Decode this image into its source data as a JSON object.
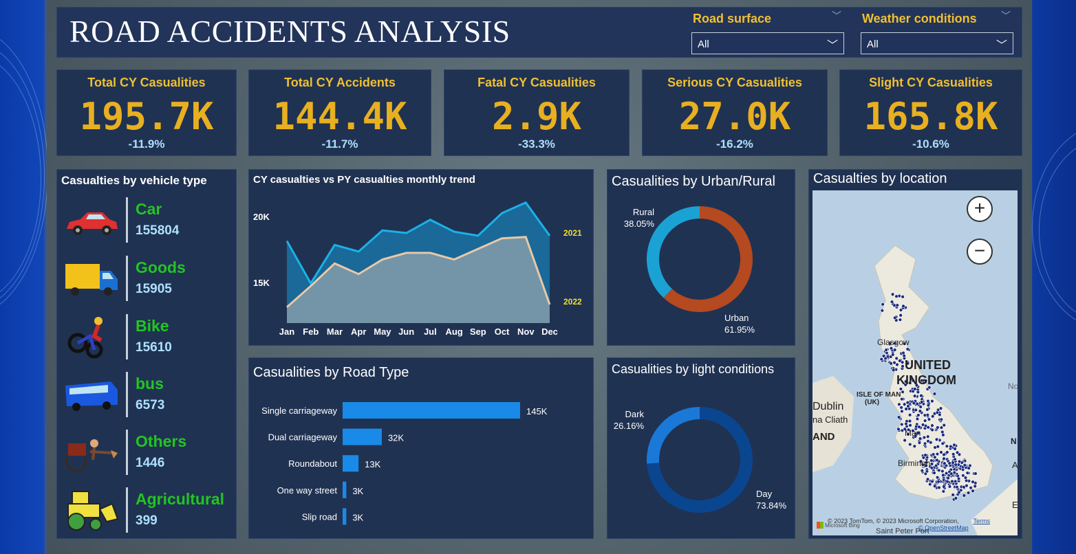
{
  "header": {
    "title": "ROAD ACCIDENTS ANALYSIS"
  },
  "filters": {
    "road_surface": {
      "label": "Road surface",
      "value": "All"
    },
    "weather": {
      "label": "Weather conditions",
      "value": "All"
    }
  },
  "kpis": [
    {
      "label": "Total CY Casualities",
      "value": "195.7K",
      "change": "-11.9%"
    },
    {
      "label": "Total CY Accidents",
      "value": "144.4K",
      "change": "-11.7%"
    },
    {
      "label": "Fatal CY Casualities",
      "value": "2.9K",
      "change": "-33.3%"
    },
    {
      "label": "Serious CY Casualities",
      "value": "27.0K",
      "change": "-16.2%"
    },
    {
      "label": "Slight CY Casualities",
      "value": "165.8K",
      "change": "-10.6%"
    }
  ],
  "vehicle_panel": {
    "title": "Casualties by vehicle type",
    "items": [
      {
        "name": "Car",
        "value": "155804",
        "icon": "car-icon"
      },
      {
        "name": "Goods",
        "value": "15905",
        "icon": "truck-icon"
      },
      {
        "name": "Bike",
        "value": "15610",
        "icon": "motorbike-icon"
      },
      {
        "name": "bus",
        "value": "6573",
        "icon": "bus-icon"
      },
      {
        "name": "Others",
        "value": "1446",
        "icon": "rickshaw-icon"
      },
      {
        "name": "Agricultural",
        "value": "399",
        "icon": "tractor-icon"
      }
    ]
  },
  "trend": {
    "title": "CY casualties vs PY casualties monthly trend"
  },
  "urban_rural": {
    "title": "Casualities by Urban/Rural"
  },
  "road_type": {
    "title": "Casualities by Road Type"
  },
  "light": {
    "title": "Casualities by light conditions"
  },
  "location": {
    "title": "Casualties by location",
    "labels": {
      "uk1": "UNITED",
      "uk2": "KINGDOM",
      "iom": "ISLE OF MAN",
      "iom2": "(UK)",
      "dublin": "Dublin",
      "glasgow": "Glasgow",
      "n": "N",
      "no": "No",
      "a": "A",
      "e": "E",
      "and": "AND",
      "cliath": "na Cliath",
      "man": "Man",
      "birm": "Birmingh"
    },
    "attribution": "© 2023 TomTom, © 2023 Microsoft Corporation,",
    "terms": "Terms",
    "osm": "© OpenStreetMap",
    "bing": "Microsoft Bing",
    "place": "Saint Peter Port",
    "zoom_in": "+",
    "zoom_out": "−"
  },
  "chart_data": [
    {
      "type": "area",
      "title": "CY casualties vs PY casualties monthly trend",
      "categories": [
        "Jan",
        "Feb",
        "Mar",
        "Apr",
        "May",
        "Jun",
        "Jul",
        "Aug",
        "Sep",
        "Oct",
        "Nov",
        "Dec"
      ],
      "y_ticks": [
        "15K",
        "20K"
      ],
      "ylim": [
        12000,
        21500
      ],
      "series": [
        {
          "name": "2021",
          "values": [
            18200,
            15000,
            17900,
            17400,
            19000,
            18800,
            19800,
            18900,
            18600,
            20300,
            21100,
            18600
          ],
          "color": "#1ab2e8"
        },
        {
          "name": "2022",
          "values": [
            13200,
            14800,
            16500,
            15700,
            16800,
            17300,
            17300,
            16800,
            17600,
            18400,
            18500,
            13400
          ],
          "color": "#e8c8a8"
        }
      ]
    },
    {
      "type": "pie",
      "title": "Casualities by Urban/Rural",
      "slices": [
        {
          "label": "Urban",
          "value": 61.95,
          "display": "61.95%",
          "color": "#b5491f"
        },
        {
          "label": "Rural",
          "value": 38.05,
          "display": "38.05%",
          "color": "#1ba2d4"
        }
      ]
    },
    {
      "type": "bar",
      "title": "Casualities by Road Type",
      "categories": [
        "Single carriageway",
        "Dual carriageway",
        "Roundabout",
        "One way street",
        "Slip road"
      ],
      "values": [
        145000,
        32000,
        13000,
        3000,
        3000
      ],
      "labels": [
        "145K",
        "32K",
        "13K",
        "3K",
        "3K"
      ],
      "color": "#1a8ae8"
    },
    {
      "type": "pie",
      "title": "Casualities by light conditions",
      "slices": [
        {
          "label": "Day",
          "value": 73.84,
          "display": "73.84%",
          "color": "#0a4690"
        },
        {
          "label": "Dark",
          "value": 26.16,
          "display": "26.16%",
          "color": "#1a78d8"
        }
      ]
    }
  ]
}
